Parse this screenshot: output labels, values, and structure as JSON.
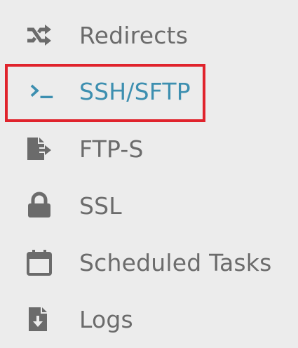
{
  "menu": {
    "items": [
      {
        "label": "Redirects",
        "icon": "shuffle-icon"
      },
      {
        "label": "SSH/SFTP",
        "icon": "terminal-icon",
        "active": true
      },
      {
        "label": "FTP-S",
        "icon": "file-export-icon"
      },
      {
        "label": "SSL",
        "icon": "lock-icon"
      },
      {
        "label": "Scheduled Tasks",
        "icon": "calendar-icon"
      },
      {
        "label": "Logs",
        "icon": "file-download-icon"
      }
    ]
  },
  "colors": {
    "background": "#ececec",
    "text": "#6b6b6b",
    "icon": "#6b6b6b",
    "active": "#3d8fb0",
    "highlight_border": "#e0232c"
  }
}
